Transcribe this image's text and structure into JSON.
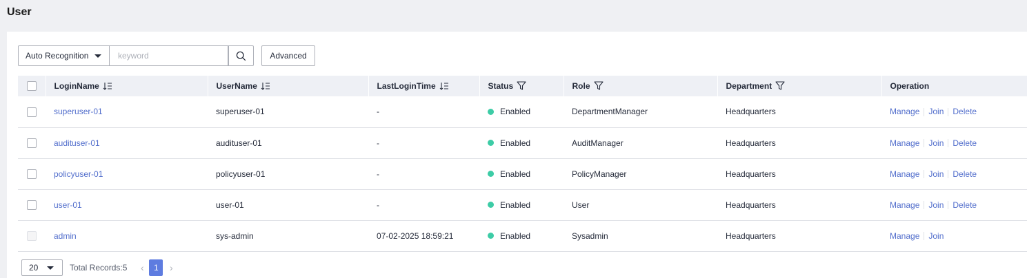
{
  "page": {
    "title": "User"
  },
  "toolbar": {
    "search_mode": "Auto Recognition",
    "keyword_placeholder": "keyword",
    "keyword_value": "",
    "advanced_label": "Advanced"
  },
  "table": {
    "columns": {
      "login_name": "LoginName",
      "user_name": "UserName",
      "last_login": "LastLoginTime",
      "status": "Status",
      "role": "Role",
      "department": "Department",
      "operation": "Operation"
    },
    "rows": [
      {
        "login_name": "superuser-01",
        "user_name": "superuser-01",
        "last_login": "-",
        "status": "Enabled",
        "role": "DepartmentManager",
        "department": "Headquarters",
        "ops": [
          "Manage",
          "Join",
          "Delete"
        ],
        "checkbox_disabled": false
      },
      {
        "login_name": "audituser-01",
        "user_name": "audituser-01",
        "last_login": "-",
        "status": "Enabled",
        "role": "AuditManager",
        "department": "Headquarters",
        "ops": [
          "Manage",
          "Join",
          "Delete"
        ],
        "checkbox_disabled": false
      },
      {
        "login_name": "policyuser-01",
        "user_name": "policyuser-01",
        "last_login": "-",
        "status": "Enabled",
        "role": "PolicyManager",
        "department": "Headquarters",
        "ops": [
          "Manage",
          "Join",
          "Delete"
        ],
        "checkbox_disabled": false
      },
      {
        "login_name": "user-01",
        "user_name": "user-01",
        "last_login": "-",
        "status": "Enabled",
        "role": "User",
        "department": "Headquarters",
        "ops": [
          "Manage",
          "Join",
          "Delete"
        ],
        "checkbox_disabled": false
      },
      {
        "login_name": "admin",
        "user_name": "sys-admin",
        "last_login": "07-02-2025 18:59:21",
        "status": "Enabled",
        "role": "Sysadmin",
        "department": "Headquarters",
        "ops": [
          "Manage",
          "Join"
        ],
        "checkbox_disabled": true
      }
    ]
  },
  "pagination": {
    "page_size": "20",
    "total_label": "Total Records:5",
    "current_page": "1",
    "prev_icon": "chevron-left-icon",
    "next_icon": "chevron-right-icon"
  },
  "colors": {
    "link": "#526ecc",
    "status_enabled": "#3dcca6",
    "page_active": "#5e7ce0",
    "header_bg": "#eef0f5"
  }
}
